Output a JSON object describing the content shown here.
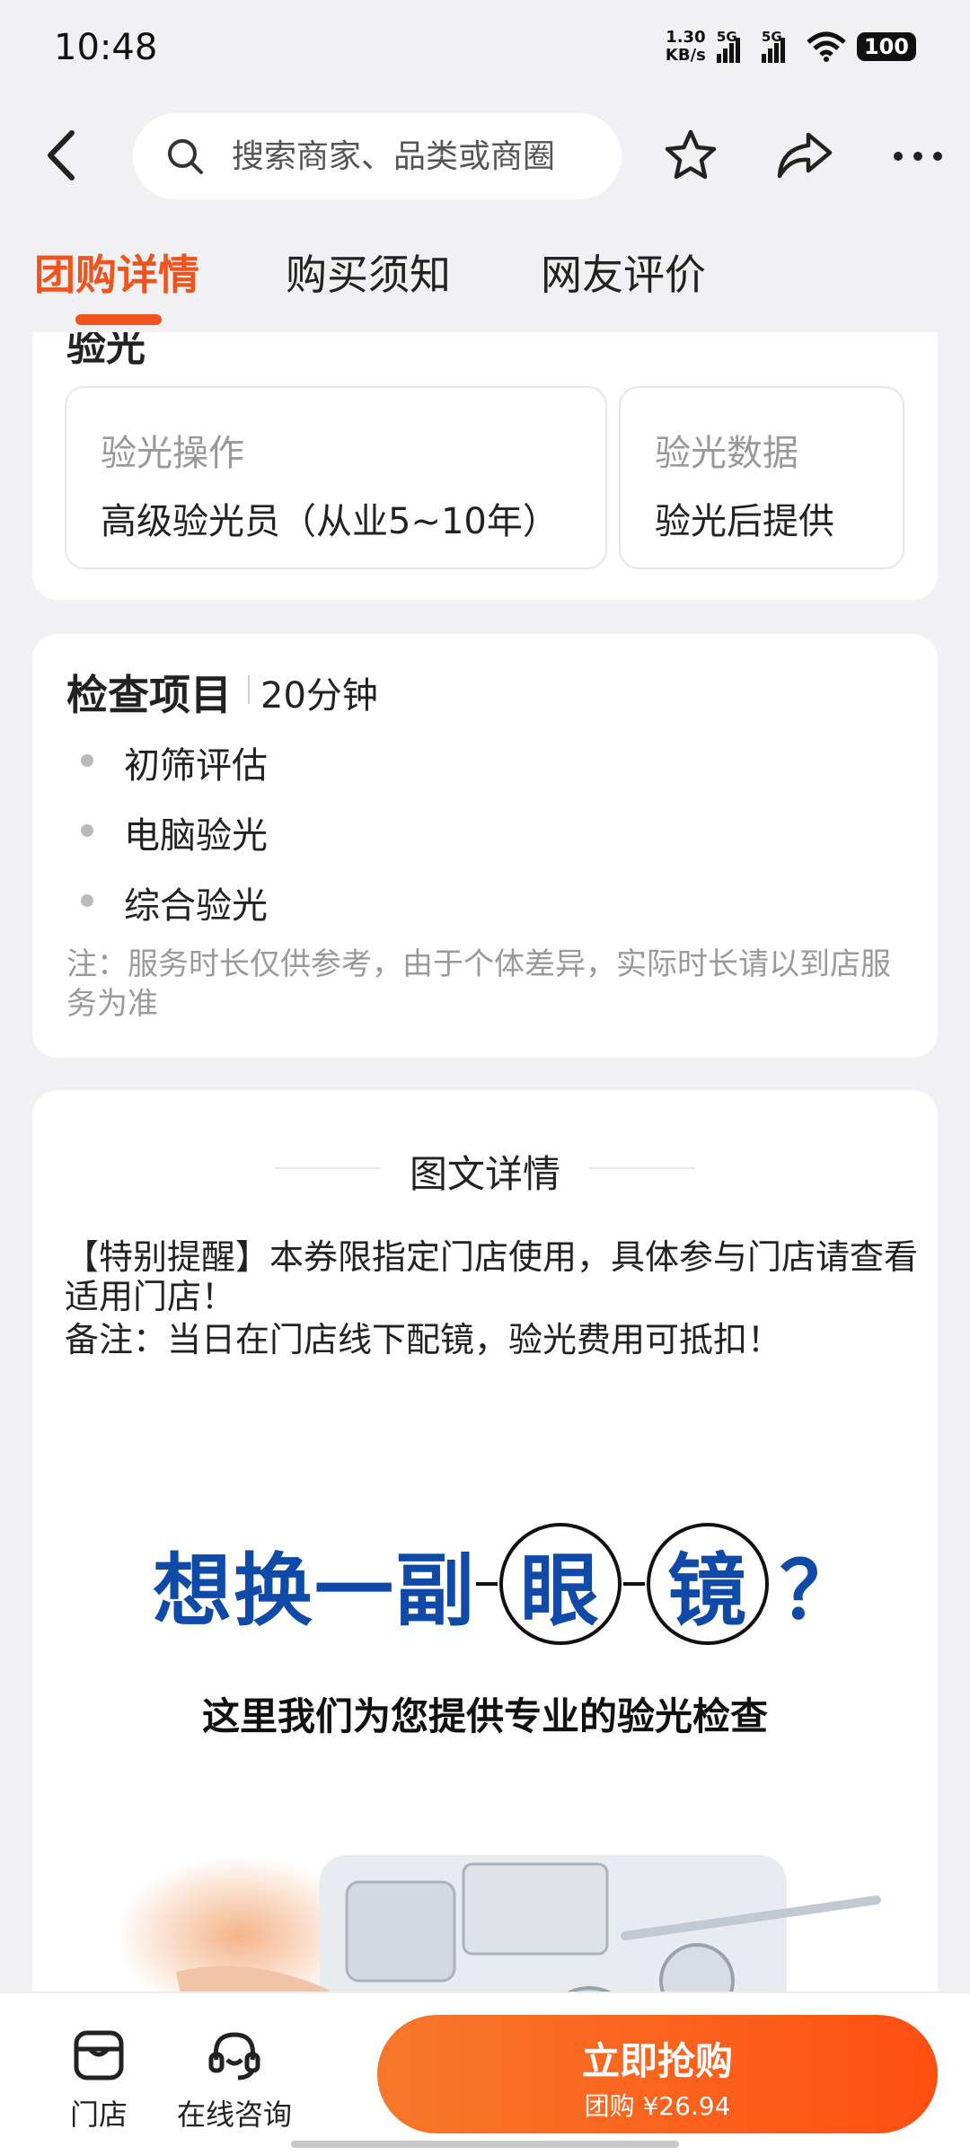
{
  "status_bar": {
    "time": "10:48",
    "net_speed_value": "1.30",
    "net_speed_unit": "KB/s",
    "signal1_label": "5G",
    "signal2_label": "5G",
    "battery": "100"
  },
  "header": {
    "search_placeholder": "搜索商家、品类或商圈"
  },
  "tabs": [
    {
      "label": "团购详情",
      "active": true
    },
    {
      "label": "购买须知",
      "active": false
    },
    {
      "label": "网友评价",
      "active": false
    }
  ],
  "optometry": {
    "cut_title": "验光",
    "operation_label": "验光操作",
    "operation_value": "高级验光员（从业5~10年）",
    "data_label": "验光数据",
    "data_value": "验光后提供"
  },
  "check": {
    "title": "检查项目",
    "duration": "20分钟",
    "items": [
      "初筛评估",
      "电脑验光",
      "综合验光"
    ],
    "note": "注：服务时长仅供参考，由于个体差异，实际时长请以到店服务为准"
  },
  "details": {
    "title": "图文详情",
    "reminder": "【特别提醒】本券限指定门店使用，具体参与门店请查看适用门店！",
    "remark": "备注：当日在门店线下配镜，验光费用可抵扣！",
    "banner_headline_part1": "想换一副",
    "banner_glass1": "眼",
    "banner_glass2": "镜",
    "banner_q": "？",
    "banner_sub": "这里我们为您提供专业的验光检查"
  },
  "bottom_bar": {
    "store_label": "门店",
    "consult_label": "在线咨询",
    "buy_label": "立即抢购",
    "buy_price": "团购 ¥26.94"
  },
  "colors": {
    "accent": "#f0531e",
    "banner_blue": "#0f4aa8"
  },
  "icons": [
    "back-icon",
    "search-icon",
    "star-icon",
    "share-icon",
    "more-icon",
    "store-icon",
    "headset-icon"
  ]
}
